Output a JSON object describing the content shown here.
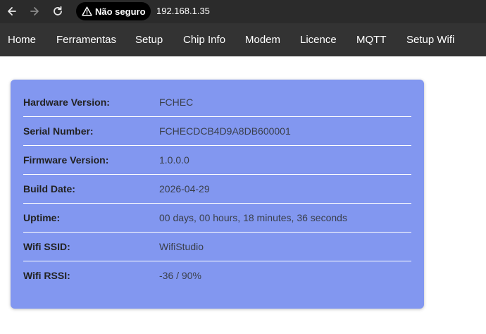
{
  "browser": {
    "security_label": "Não seguro",
    "address": "192.168.1.35"
  },
  "nav": {
    "items": [
      {
        "label": "Home"
      },
      {
        "label": "Ferramentas"
      },
      {
        "label": "Setup"
      },
      {
        "label": "Chip Info"
      },
      {
        "label": "Modem"
      },
      {
        "label": "Licence"
      },
      {
        "label": "MQTT"
      },
      {
        "label": "Setup Wifi"
      }
    ]
  },
  "info": {
    "rows": [
      {
        "label": "Hardware Version:",
        "value": "FCHEC"
      },
      {
        "label": "Serial Number:",
        "value": "FCHECDCB4D9A8DB600001"
      },
      {
        "label": "Firmware Version:",
        "value": "1.0.0.0"
      },
      {
        "label": "Build Date:",
        "value": "2026-04-29"
      },
      {
        "label": "Uptime:",
        "value": "00 days, 00 hours, 18 minutes, 36 seconds"
      },
      {
        "label": "Wifi SSID:",
        "value": "WifiStudio"
      },
      {
        "label": "Wifi RSSI:",
        "value": "-36 / 90%"
      }
    ]
  },
  "colors": {
    "browser_bar": "#2b2b2b",
    "nav_bar": "#333333",
    "card": "#8297f0"
  }
}
